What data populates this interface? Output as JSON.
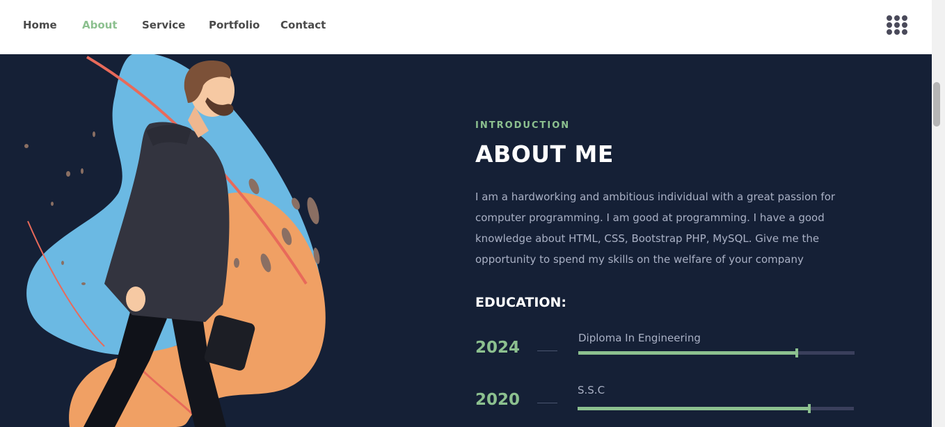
{
  "nav": {
    "items": [
      {
        "label": "Home",
        "active": false
      },
      {
        "label": "About",
        "active": true
      },
      {
        "label": "Service",
        "active": false
      },
      {
        "label": "Portfolio",
        "active": false
      },
      {
        "label": "Contact",
        "active": false
      }
    ],
    "menu_icon": "grid-menu-icon"
  },
  "about": {
    "intro_label": "INTRODUCTION",
    "title": "ABOUT ME",
    "paragraph_lines": [
      "I am a hardworking and ambitious individual with a great passion for",
      "computer programming. I am good at programming. I have a good",
      "knowledge about HTML, CSS, Bootstrap PHP, MySQL. Give me the",
      "opportunity to spend my skills on the welfare of your company"
    ],
    "education_title": "EDUCATION:",
    "education": [
      {
        "year": "2024",
        "name": "Diploma In Engineering",
        "progress": 0.79
      },
      {
        "year": "2020",
        "name": "S.S.C",
        "progress": 0.84
      }
    ]
  },
  "colors": {
    "accent": "#8cc08f",
    "background": "#152036",
    "navbar": "#ffffff",
    "text_muted": "#a9b0c4",
    "blob_blue": "#6bb9e3",
    "blob_orange": "#f0a064"
  }
}
